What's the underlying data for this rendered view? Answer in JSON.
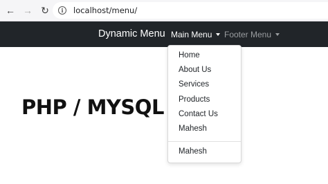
{
  "browser": {
    "url": "localhost/menu/",
    "back_icon": "arrow-left-icon",
    "forward_icon": "arrow-right-icon",
    "reload_icon": "reload-icon",
    "info_icon": "info-icon"
  },
  "navbar": {
    "brand": "Dynamic Menu",
    "main_menu_label": "Main Menu",
    "footer_menu_label": "Footer Menu",
    "background": "#212529"
  },
  "dropdown": {
    "items": [
      "Home",
      "About Us",
      "Services",
      "Products",
      "Contact Us",
      "Mahesh"
    ],
    "after_divider": [
      "Mahesh"
    ]
  },
  "hero": {
    "title": "PHP / MYSQL"
  }
}
